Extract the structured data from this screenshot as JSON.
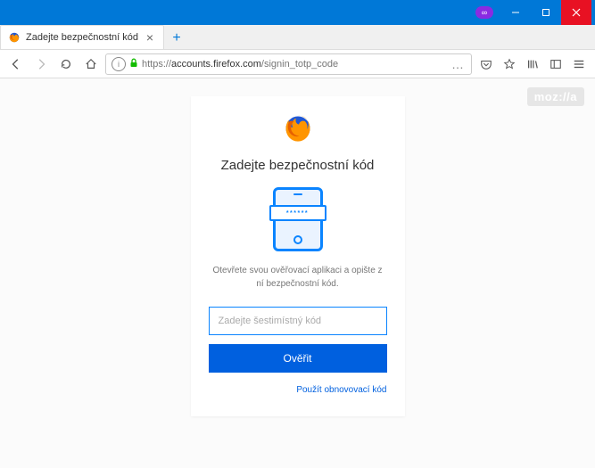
{
  "window": {
    "mask_label": "∞"
  },
  "tab": {
    "title": "Zadejte bezpečnostní kód"
  },
  "url": {
    "protocol": "https://",
    "host": "accounts.firefox.com",
    "path": "/signin_totp_code"
  },
  "nav": {
    "dots": "…"
  },
  "brand": {
    "badge": "moz://a"
  },
  "card": {
    "heading": "Zadejte bezpečnostní kód",
    "code_mask": "******",
    "instructions": "Otevřete svou ověřovací aplikaci a opište z ní bezpečnostní kód.",
    "input_placeholder": "Zadejte šestimístný kód",
    "verify_label": "Ověřit",
    "recovery_label": "Použít obnovovací kód"
  }
}
